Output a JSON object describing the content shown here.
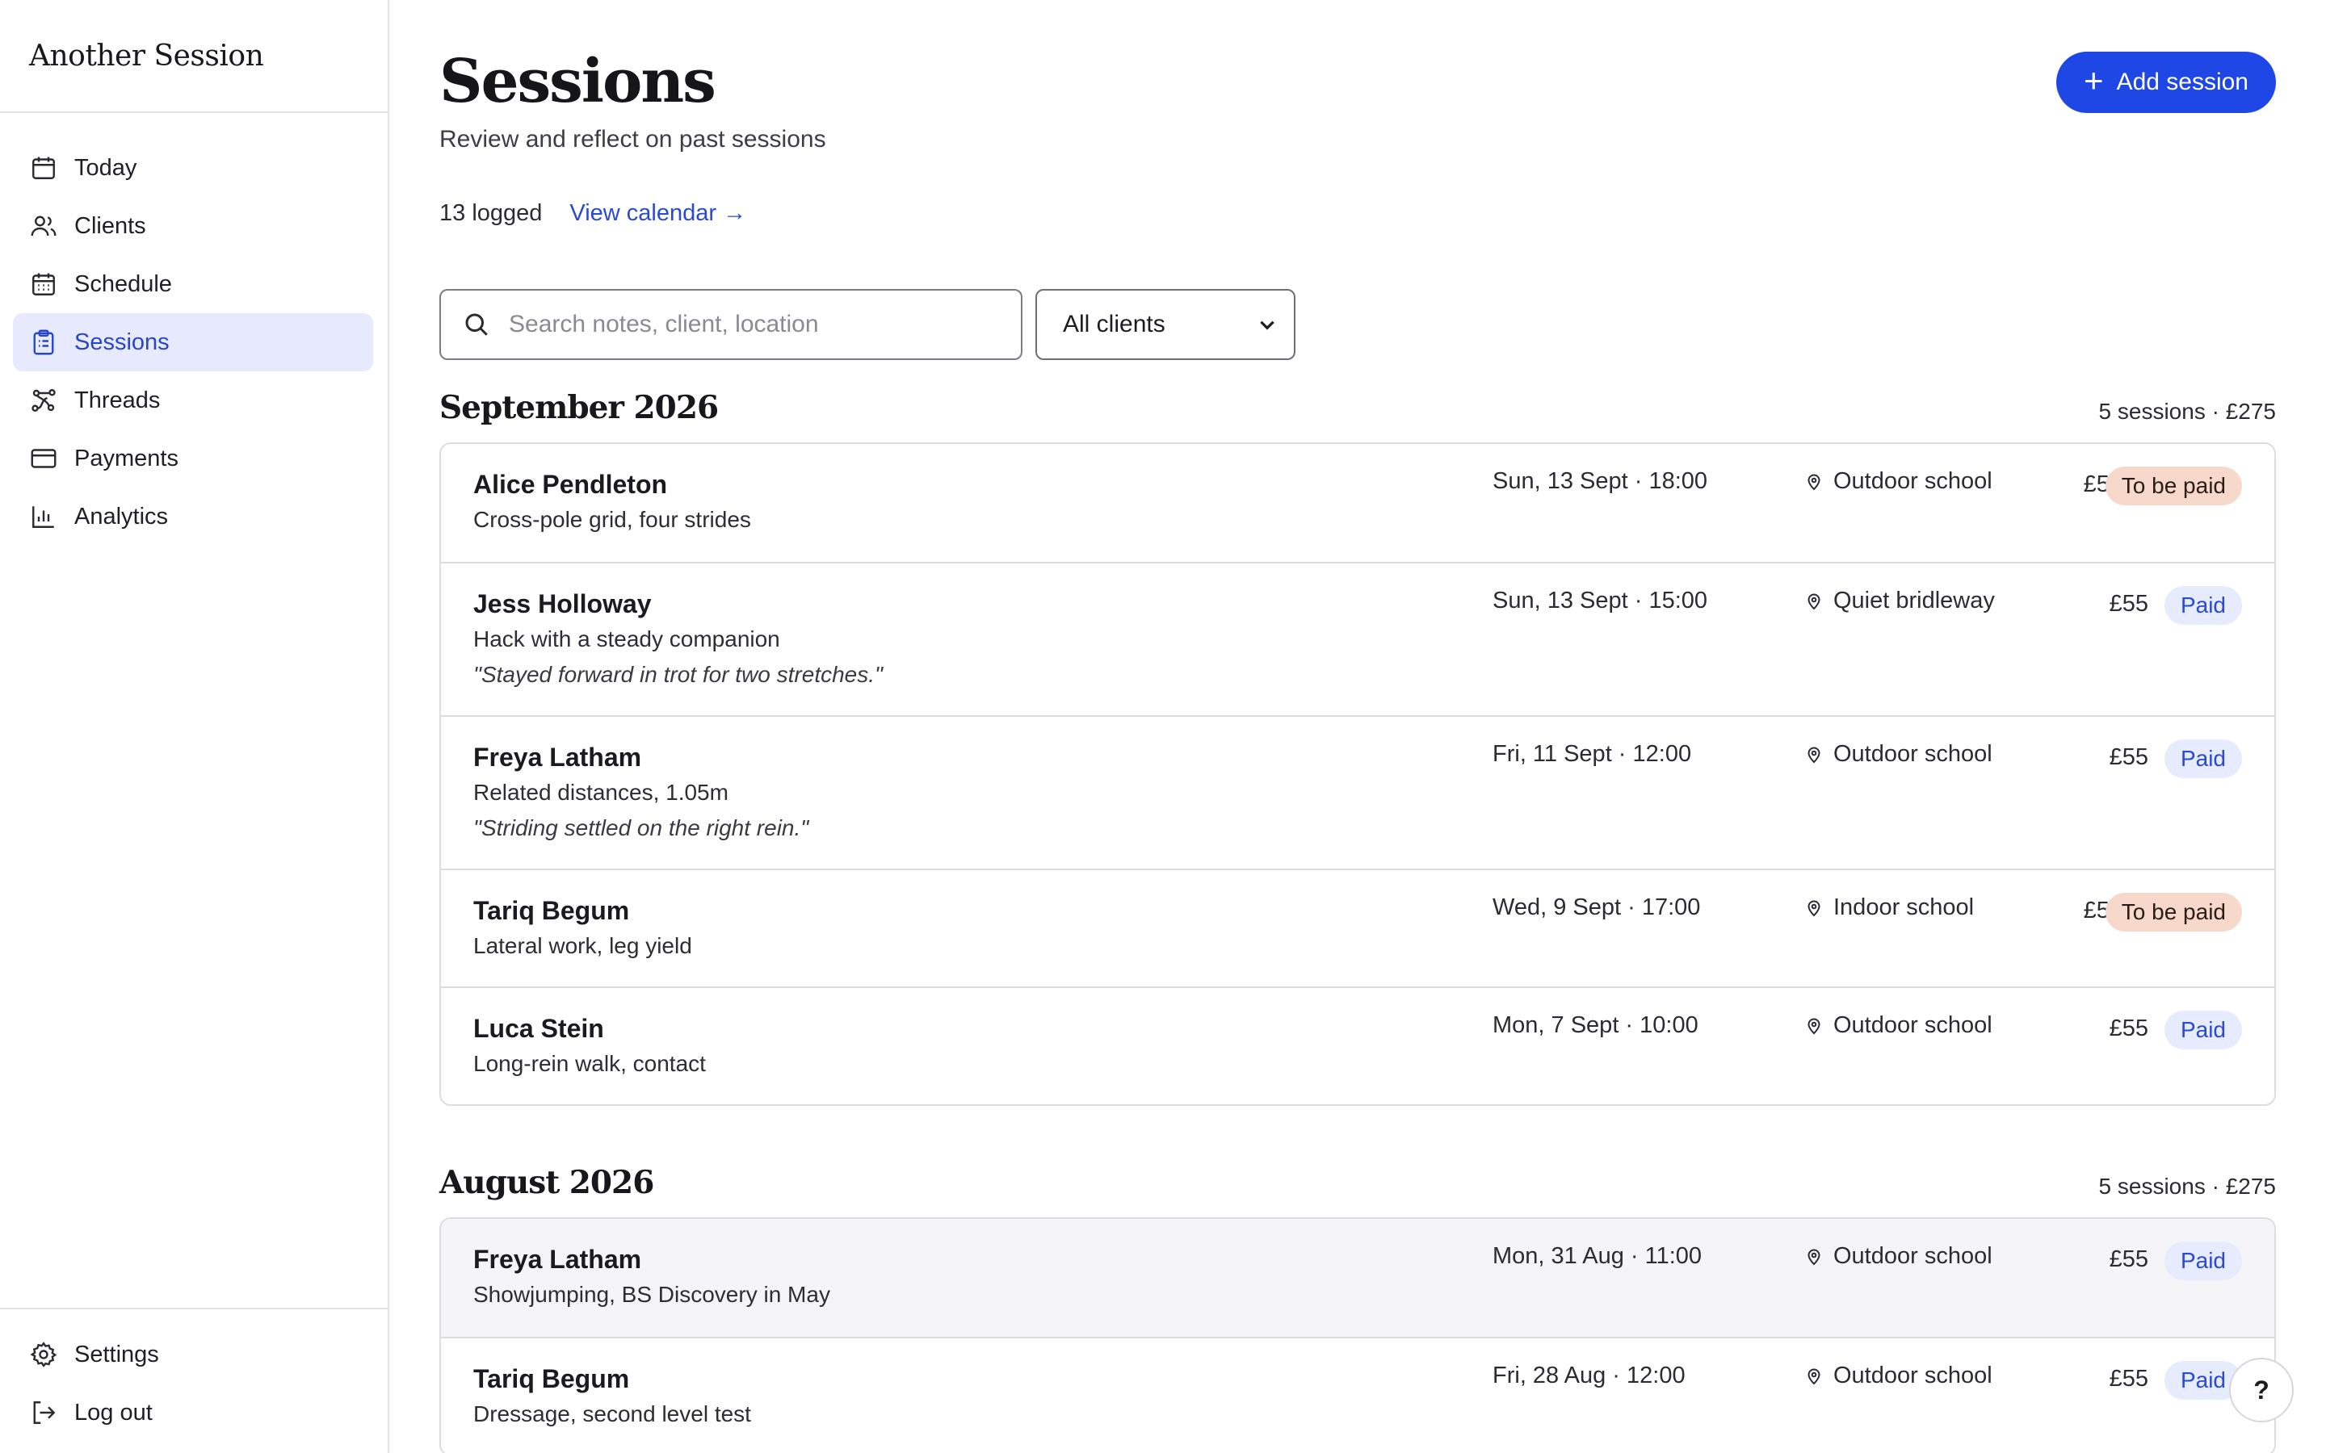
{
  "app": {
    "brand": "Another Session"
  },
  "sidebar": {
    "items": [
      {
        "label": "Today",
        "icon": "calendar-icon"
      },
      {
        "label": "Clients",
        "icon": "users-icon"
      },
      {
        "label": "Schedule",
        "icon": "calendar-grid-icon"
      },
      {
        "label": "Sessions",
        "icon": "clipboard-icon",
        "active": true
      },
      {
        "label": "Threads",
        "icon": "threads-icon"
      },
      {
        "label": "Payments",
        "icon": "card-icon"
      },
      {
        "label": "Analytics",
        "icon": "bar-chart-icon"
      }
    ],
    "bottom": [
      {
        "label": "Settings",
        "icon": "gear-icon"
      },
      {
        "label": "Log out",
        "icon": "logout-icon"
      }
    ]
  },
  "header": {
    "title": "Sessions",
    "subtitle": "Review and reflect on past sessions",
    "add_button": "Add session",
    "logged_count": "13 logged",
    "calendar_link": "View calendar →"
  },
  "filters": {
    "search_placeholder": "Search notes, client, location",
    "client_select": "All clients"
  },
  "groups": [
    {
      "title": "September 2026",
      "meta": "5 sessions · £275",
      "sessions": [
        {
          "name": "Alice Pendleton",
          "desc": "Cross-pole grid, four strides",
          "quote": "",
          "date": "Sun, 13 Sept · 18:00",
          "location": "Outdoor school",
          "price": "£55",
          "status": "To be paid"
        },
        {
          "name": "Jess Holloway",
          "desc": "Hack with a steady companion",
          "quote": "\"Stayed forward in trot for two stretches.\"",
          "date": "Sun, 13 Sept · 15:00",
          "location": "Quiet bridleway",
          "price": "£55",
          "status": "Paid"
        },
        {
          "name": "Freya Latham",
          "desc": "Related distances, 1.05m",
          "quote": "\"Striding settled on the right rein.\"",
          "date": "Fri, 11 Sept · 12:00",
          "location": "Outdoor school",
          "price": "£55",
          "status": "Paid"
        },
        {
          "name": "Tariq Begum",
          "desc": "Lateral work, leg yield",
          "quote": "",
          "date": "Wed, 9 Sept · 17:00",
          "location": "Indoor school",
          "price": "£55",
          "status": "To be paid"
        },
        {
          "name": "Luca Stein",
          "desc": "Long-rein walk, contact",
          "quote": "",
          "date": "Mon, 7 Sept · 10:00",
          "location": "Outdoor school",
          "price": "£55",
          "status": "Paid"
        }
      ]
    },
    {
      "title": "August 2026",
      "meta": "5 sessions · £275",
      "sessions": [
        {
          "name": "Freya Latham",
          "desc": "Showjumping, BS Discovery in May",
          "quote": "",
          "date": "Mon, 31 Aug · 11:00",
          "location": "Outdoor school",
          "price": "£55",
          "status": "Paid"
        },
        {
          "name": "Tariq Begum",
          "desc": "Dressage, second level test",
          "quote": "",
          "date": "Fri, 28 Aug · 12:00",
          "location": "Outdoor school",
          "price": "£55",
          "status": "Paid"
        }
      ]
    }
  ],
  "help": {
    "label": "?"
  },
  "colors": {
    "accent": "#1f47e6",
    "active_nav_bg": "#e7eafc",
    "paid_bg": "#e6ebfd",
    "due_bg": "#f7d9cc"
  }
}
